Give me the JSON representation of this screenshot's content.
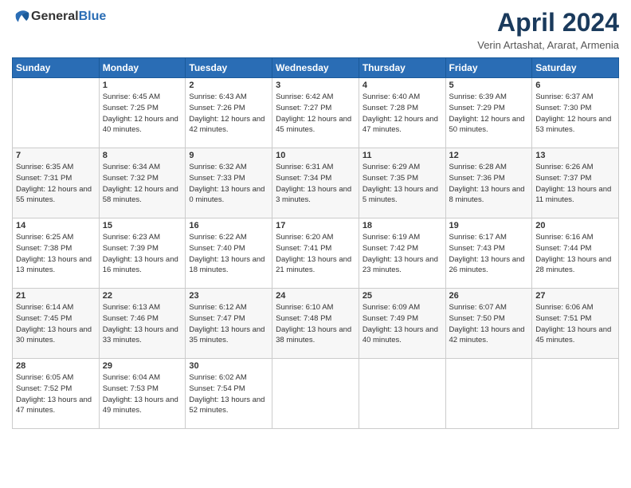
{
  "header": {
    "logo_general": "General",
    "logo_blue": "Blue",
    "title": "April 2024",
    "location": "Verin Artashat, Ararat, Armenia"
  },
  "days_of_week": [
    "Sunday",
    "Monday",
    "Tuesday",
    "Wednesday",
    "Thursday",
    "Friday",
    "Saturday"
  ],
  "weeks": [
    {
      "alt": false,
      "cells": [
        {
          "day": "",
          "sunrise": "",
          "sunset": "",
          "daylight": ""
        },
        {
          "day": "1",
          "sunrise": "Sunrise: 6:45 AM",
          "sunset": "Sunset: 7:25 PM",
          "daylight": "Daylight: 12 hours and 40 minutes."
        },
        {
          "day": "2",
          "sunrise": "Sunrise: 6:43 AM",
          "sunset": "Sunset: 7:26 PM",
          "daylight": "Daylight: 12 hours and 42 minutes."
        },
        {
          "day": "3",
          "sunrise": "Sunrise: 6:42 AM",
          "sunset": "Sunset: 7:27 PM",
          "daylight": "Daylight: 12 hours and 45 minutes."
        },
        {
          "day": "4",
          "sunrise": "Sunrise: 6:40 AM",
          "sunset": "Sunset: 7:28 PM",
          "daylight": "Daylight: 12 hours and 47 minutes."
        },
        {
          "day": "5",
          "sunrise": "Sunrise: 6:39 AM",
          "sunset": "Sunset: 7:29 PM",
          "daylight": "Daylight: 12 hours and 50 minutes."
        },
        {
          "day": "6",
          "sunrise": "Sunrise: 6:37 AM",
          "sunset": "Sunset: 7:30 PM",
          "daylight": "Daylight: 12 hours and 53 minutes."
        }
      ]
    },
    {
      "alt": true,
      "cells": [
        {
          "day": "7",
          "sunrise": "Sunrise: 6:35 AM",
          "sunset": "Sunset: 7:31 PM",
          "daylight": "Daylight: 12 hours and 55 minutes."
        },
        {
          "day": "8",
          "sunrise": "Sunrise: 6:34 AM",
          "sunset": "Sunset: 7:32 PM",
          "daylight": "Daylight: 12 hours and 58 minutes."
        },
        {
          "day": "9",
          "sunrise": "Sunrise: 6:32 AM",
          "sunset": "Sunset: 7:33 PM",
          "daylight": "Daylight: 13 hours and 0 minutes."
        },
        {
          "day": "10",
          "sunrise": "Sunrise: 6:31 AM",
          "sunset": "Sunset: 7:34 PM",
          "daylight": "Daylight: 13 hours and 3 minutes."
        },
        {
          "day": "11",
          "sunrise": "Sunrise: 6:29 AM",
          "sunset": "Sunset: 7:35 PM",
          "daylight": "Daylight: 13 hours and 5 minutes."
        },
        {
          "day": "12",
          "sunrise": "Sunrise: 6:28 AM",
          "sunset": "Sunset: 7:36 PM",
          "daylight": "Daylight: 13 hours and 8 minutes."
        },
        {
          "day": "13",
          "sunrise": "Sunrise: 6:26 AM",
          "sunset": "Sunset: 7:37 PM",
          "daylight": "Daylight: 13 hours and 11 minutes."
        }
      ]
    },
    {
      "alt": false,
      "cells": [
        {
          "day": "14",
          "sunrise": "Sunrise: 6:25 AM",
          "sunset": "Sunset: 7:38 PM",
          "daylight": "Daylight: 13 hours and 13 minutes."
        },
        {
          "day": "15",
          "sunrise": "Sunrise: 6:23 AM",
          "sunset": "Sunset: 7:39 PM",
          "daylight": "Daylight: 13 hours and 16 minutes."
        },
        {
          "day": "16",
          "sunrise": "Sunrise: 6:22 AM",
          "sunset": "Sunset: 7:40 PM",
          "daylight": "Daylight: 13 hours and 18 minutes."
        },
        {
          "day": "17",
          "sunrise": "Sunrise: 6:20 AM",
          "sunset": "Sunset: 7:41 PM",
          "daylight": "Daylight: 13 hours and 21 minutes."
        },
        {
          "day": "18",
          "sunrise": "Sunrise: 6:19 AM",
          "sunset": "Sunset: 7:42 PM",
          "daylight": "Daylight: 13 hours and 23 minutes."
        },
        {
          "day": "19",
          "sunrise": "Sunrise: 6:17 AM",
          "sunset": "Sunset: 7:43 PM",
          "daylight": "Daylight: 13 hours and 26 minutes."
        },
        {
          "day": "20",
          "sunrise": "Sunrise: 6:16 AM",
          "sunset": "Sunset: 7:44 PM",
          "daylight": "Daylight: 13 hours and 28 minutes."
        }
      ]
    },
    {
      "alt": true,
      "cells": [
        {
          "day": "21",
          "sunrise": "Sunrise: 6:14 AM",
          "sunset": "Sunset: 7:45 PM",
          "daylight": "Daylight: 13 hours and 30 minutes."
        },
        {
          "day": "22",
          "sunrise": "Sunrise: 6:13 AM",
          "sunset": "Sunset: 7:46 PM",
          "daylight": "Daylight: 13 hours and 33 minutes."
        },
        {
          "day": "23",
          "sunrise": "Sunrise: 6:12 AM",
          "sunset": "Sunset: 7:47 PM",
          "daylight": "Daylight: 13 hours and 35 minutes."
        },
        {
          "day": "24",
          "sunrise": "Sunrise: 6:10 AM",
          "sunset": "Sunset: 7:48 PM",
          "daylight": "Daylight: 13 hours and 38 minutes."
        },
        {
          "day": "25",
          "sunrise": "Sunrise: 6:09 AM",
          "sunset": "Sunset: 7:49 PM",
          "daylight": "Daylight: 13 hours and 40 minutes."
        },
        {
          "day": "26",
          "sunrise": "Sunrise: 6:07 AM",
          "sunset": "Sunset: 7:50 PM",
          "daylight": "Daylight: 13 hours and 42 minutes."
        },
        {
          "day": "27",
          "sunrise": "Sunrise: 6:06 AM",
          "sunset": "Sunset: 7:51 PM",
          "daylight": "Daylight: 13 hours and 45 minutes."
        }
      ]
    },
    {
      "alt": false,
      "cells": [
        {
          "day": "28",
          "sunrise": "Sunrise: 6:05 AM",
          "sunset": "Sunset: 7:52 PM",
          "daylight": "Daylight: 13 hours and 47 minutes."
        },
        {
          "day": "29",
          "sunrise": "Sunrise: 6:04 AM",
          "sunset": "Sunset: 7:53 PM",
          "daylight": "Daylight: 13 hours and 49 minutes."
        },
        {
          "day": "30",
          "sunrise": "Sunrise: 6:02 AM",
          "sunset": "Sunset: 7:54 PM",
          "daylight": "Daylight: 13 hours and 52 minutes."
        },
        {
          "day": "",
          "sunrise": "",
          "sunset": "",
          "daylight": ""
        },
        {
          "day": "",
          "sunrise": "",
          "sunset": "",
          "daylight": ""
        },
        {
          "day": "",
          "sunrise": "",
          "sunset": "",
          "daylight": ""
        },
        {
          "day": "",
          "sunrise": "",
          "sunset": "",
          "daylight": ""
        }
      ]
    }
  ]
}
